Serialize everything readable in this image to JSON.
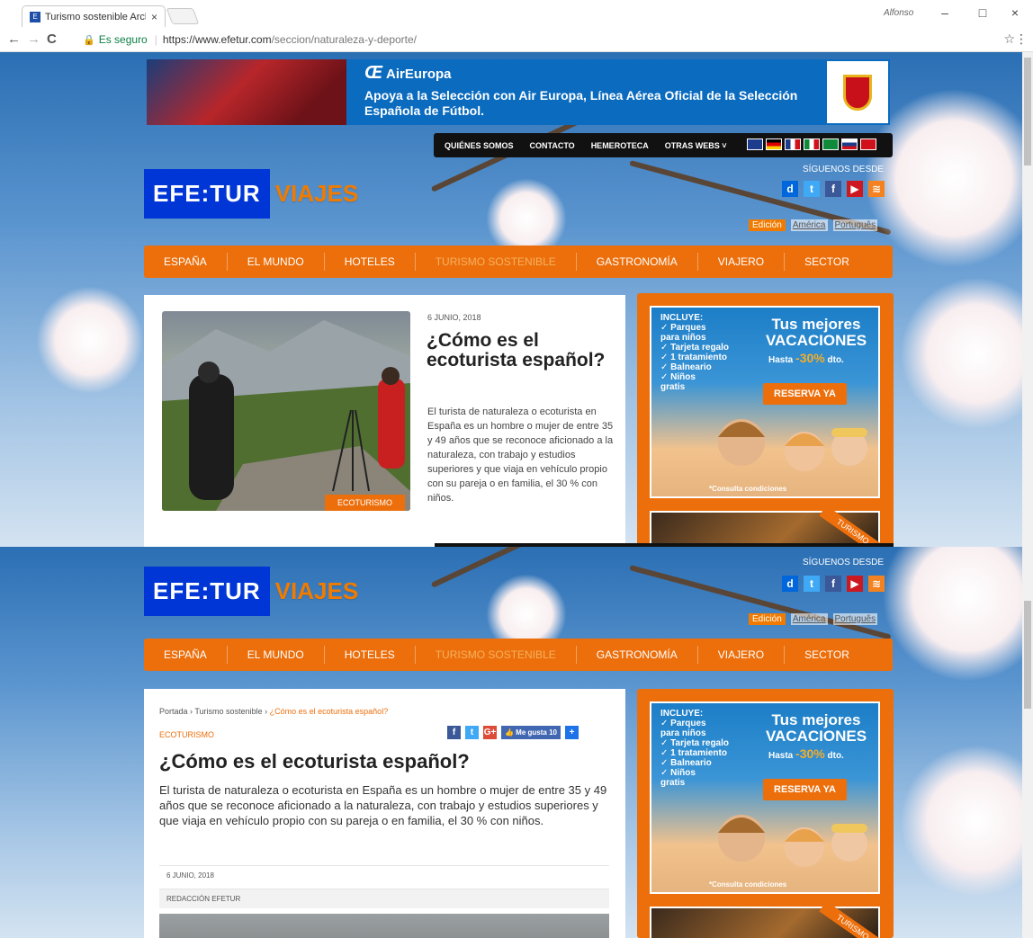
{
  "browser": {
    "tab_title": "Turismo sostenible Archi",
    "tab_favicon": "efe-favicon",
    "tab_close": "×",
    "window_user": "Alfonso",
    "win_min": "–",
    "win_max": "□",
    "win_close": "×",
    "back": "←",
    "forward": "→",
    "reload": "C",
    "secure_label": "Es seguro",
    "url_host": "https://www.efetur.com",
    "url_path": "/seccion/naturaleza-y-deporte/",
    "star": "☆",
    "menu": "⋮"
  },
  "ad_banner": {
    "brand_symbol": "Œ",
    "brand": "AirEuropa",
    "text": "Apoya a la Selección con Air Europa, Línea Aérea Oficial de la Selección Española de Fútbol."
  },
  "top_menu": {
    "items": [
      "QUIÉNES SOMOS",
      "CONTACTO",
      "HEMEROTECA",
      "OTRAS WEBS ˅"
    ],
    "flags": [
      "#1e3c8c",
      "#000000",
      "#1e3c8c",
      "#0f8a3a",
      "#0f8a3a",
      "#1e3c8c",
      "#d0101a"
    ]
  },
  "logo": {
    "efe": "EFE:TUR",
    "viajes": "VIAJES"
  },
  "social": {
    "label": "SÍGUENOS DESDE",
    "icons": [
      {
        "name": "dailymotion-icon",
        "glyph": "d",
        "color": "#0066dc"
      },
      {
        "name": "twitter-icon",
        "glyph": "t",
        "color": "#3fa9f5"
      },
      {
        "name": "facebook-icon",
        "glyph": "f",
        "color": "#3b5998"
      },
      {
        "name": "youtube-icon",
        "glyph": "▶",
        "color": "#cc181e"
      },
      {
        "name": "rss-icon",
        "glyph": "≋",
        "color": "#f58220"
      }
    ]
  },
  "editions": {
    "active": "Edición",
    "america": "América",
    "portugues": "Português"
  },
  "main_nav": [
    "ESPAÑA",
    "EL MUNDO",
    "HOTELES",
    "TURISMO SOSTENIBLE",
    "GASTRONOMÍA",
    "VIAJERO",
    "SECTOR"
  ],
  "featured": {
    "date": "6 JUNIO, 2018",
    "title": "¿Cómo es el ecoturista español?",
    "excerpt": "El turista de naturaleza o ecoturista en España es un hombre o mujer de entre 35 y 49 años que se reconoce aficionado a la naturaleza, con trabajo y estudios superiores y que viaja en vehículo propio con su pareja o en familia, el 30 % con niños.",
    "tag": "ECOTURISMO"
  },
  "side_ad": {
    "incluye": "INCLUYE:",
    "items": [
      "✓ Parques",
      "  para niños",
      "✓ Tarjeta regalo",
      "✓ 1 tratamiento",
      "✓ Balneario",
      "✓ Niños",
      "  gratis"
    ],
    "headline1": "Tus mejores",
    "headline2": "VACACIONES",
    "discount_pre": "Hasta",
    "discount": "-30%",
    "discount_post": "dto.",
    "button": "RESERVA YA",
    "conditions": "*Consulta condiciones",
    "ribbon": "TURISMO"
  },
  "article": {
    "breadcrumb_home": "Portada",
    "breadcrumb_section": "Turismo sostenible",
    "breadcrumb_current": "¿Cómo es el ecoturista español?",
    "breadcrumb_sep": "›",
    "category": "ECOTURISMO",
    "share": [
      {
        "name": "facebook-share-icon",
        "glyph": "f",
        "color": "#3b5998"
      },
      {
        "name": "twitter-share-icon",
        "glyph": "t",
        "color": "#3fa9f5"
      },
      {
        "name": "google-plus-share-icon",
        "glyph": "G+",
        "color": "#dd4b39"
      },
      {
        "name": "like-button",
        "glyph": "👍 Me gusta 10",
        "color": "#4267b2"
      },
      {
        "name": "more-share-icon",
        "glyph": "+",
        "color": "#1e73e8"
      }
    ],
    "title": "¿Cómo es el ecoturista español?",
    "lead": "El turista de naturaleza o ecoturista en España es un hombre o mujer de entre 35 y 49 años que se reconoce aficionado a la naturaleza, con trabajo y estudios superiores y que viaja en vehículo propio con su pareja o en familia, el 30 % con niños.",
    "date": "6 JUNIO, 2018",
    "author": "REDACCIÓN EFETUR"
  },
  "colors": {
    "accent": "#ec6f0c",
    "efe_blue": "#0036d6",
    "secure": "#0b8043"
  }
}
